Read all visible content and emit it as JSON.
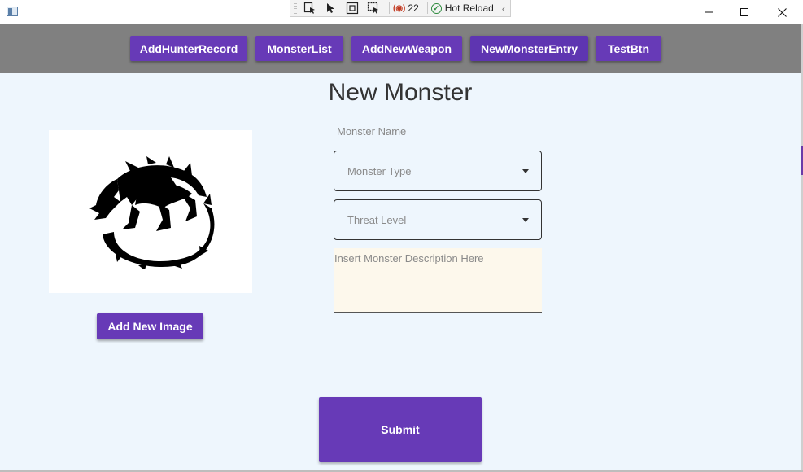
{
  "window": {
    "icon": "app-window-icon",
    "controls": {
      "minimize_icon": "minimize-icon",
      "maximize_icon": "maximize-icon",
      "close_icon": "close-icon"
    }
  },
  "debug_toolbar": {
    "tools": [
      "select-element-icon",
      "pointer-icon",
      "display-layout-adorners-icon",
      "track-focused-element-icon"
    ],
    "binding_failures_count": "22",
    "hot_reload_label": "Hot Reload",
    "collapse_icon": "chevron-left-icon"
  },
  "nav": {
    "buttons": [
      {
        "label": "AddHunterRecord",
        "active": false
      },
      {
        "label": "MonsterList",
        "active": false
      },
      {
        "label": "AddNewWeapon",
        "active": false
      },
      {
        "label": "NewMonsterEntry",
        "active": true
      },
      {
        "label": "TestBtn",
        "active": false
      }
    ]
  },
  "page": {
    "title": "New Monster",
    "image_alt_icon": "monster-silhouette-icon",
    "add_image_label": "Add New Image",
    "form": {
      "name_placeholder": "Monster Name",
      "type_placeholder": "Monster Type",
      "threat_placeholder": "Threat Level",
      "description_placeholder": "Insert Monster Description Here",
      "submit_label": "Submit"
    }
  },
  "colors": {
    "accent": "#673ab7",
    "nav_background": "#808080",
    "content_background": "#eef6fd",
    "description_background": "#fdf8ec"
  }
}
